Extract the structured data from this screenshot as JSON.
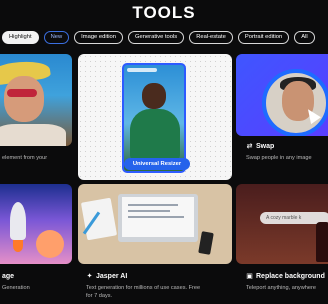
{
  "header": {
    "title": "TOOLS"
  },
  "filters": [
    {
      "label": "Highlight",
      "active": true
    },
    {
      "label": "New",
      "active": false
    },
    {
      "label": "Image edition",
      "active": false
    },
    {
      "label": "Generative tools",
      "active": false
    },
    {
      "label": "Real-estate",
      "active": false
    },
    {
      "label": "Portrait edition",
      "active": false
    },
    {
      "label": "All",
      "active": false
    }
  ],
  "cards": {
    "top_left": {
      "desc": "element from your"
    },
    "center": {
      "button": "Universal Resizer"
    },
    "top_right": {
      "label": "Swap",
      "desc": "Swap people in any image",
      "icon": "swap-icon"
    },
    "bottom_left": {
      "label": "age",
      "desc": "Generation"
    },
    "bottom_center": {
      "label": "Jasper AI",
      "desc1": "Text generation for millions of use cases. Free",
      "desc2": "for 7 days.",
      "icon": "sparkle-icon"
    },
    "bottom_right": {
      "label": "Replace background",
      "desc": "Teleport anything, anywhere",
      "prompt": "A cozy marble k",
      "icon": "image-icon"
    }
  },
  "colors": {
    "accent": "#2563eb",
    "background": "#0b0b0c"
  }
}
